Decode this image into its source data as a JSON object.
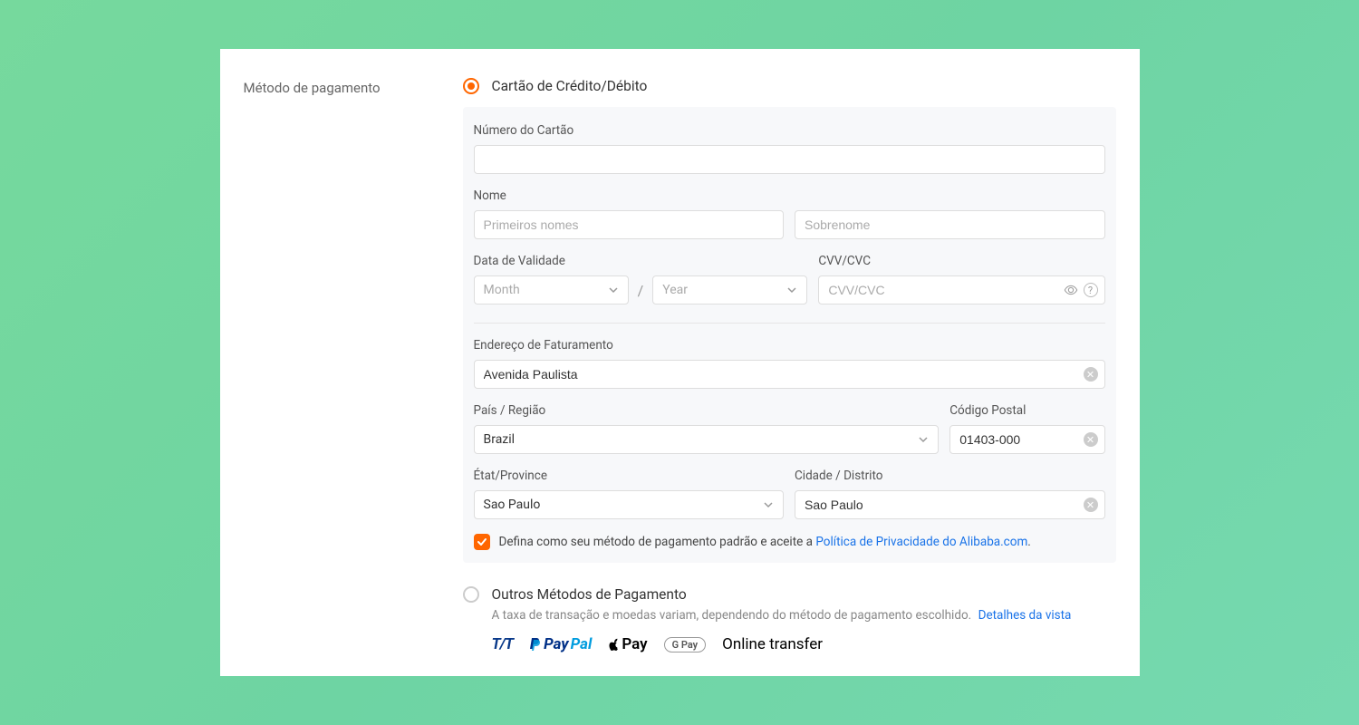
{
  "section_title": "Método de pagamento",
  "credit_card": {
    "radio_label": "Cartão de Crédito/Débito",
    "card_number_label": "Número do Cartão",
    "card_number_value": "",
    "name_label": "Nome",
    "first_name_placeholder": "Primeiros nomes",
    "first_name_value": "",
    "last_name_placeholder": "Sobrenome",
    "last_name_value": "",
    "expiry_label": "Data de Validade",
    "month_placeholder": "Month",
    "year_placeholder": "Year",
    "cvv_label": "CVV/CVC",
    "cvv_placeholder": "CVV/CVC",
    "cvv_value": "",
    "billing_label": "Endereço de Faturamento",
    "billing_value": "Avenida Paulista",
    "country_label": "País / Região",
    "country_value": "Brazil",
    "postal_label": "Código Postal",
    "postal_value": "01403-000",
    "state_label": "État/Province",
    "state_value": "Sao Paulo",
    "city_label": "Cidade / Distrito",
    "city_value": "Sao Paulo",
    "default_text_a": "Defina como seu método de pagamento padrão e aceite a ",
    "default_link": "Política de Privacidade do Alibaba.com",
    "default_text_b": "."
  },
  "other": {
    "radio_label": "Outros Métodos de Pagamento",
    "subtitle": "A taxa de transação e moedas variam, dependendo do método de pagamento escolhido.",
    "details_link": "Detalhes da vista",
    "logos": {
      "tt": "T/T",
      "paypal": "PayPal",
      "applepay": "Pay",
      "gpay": "G Pay",
      "online_transfer": "Online transfer"
    }
  }
}
